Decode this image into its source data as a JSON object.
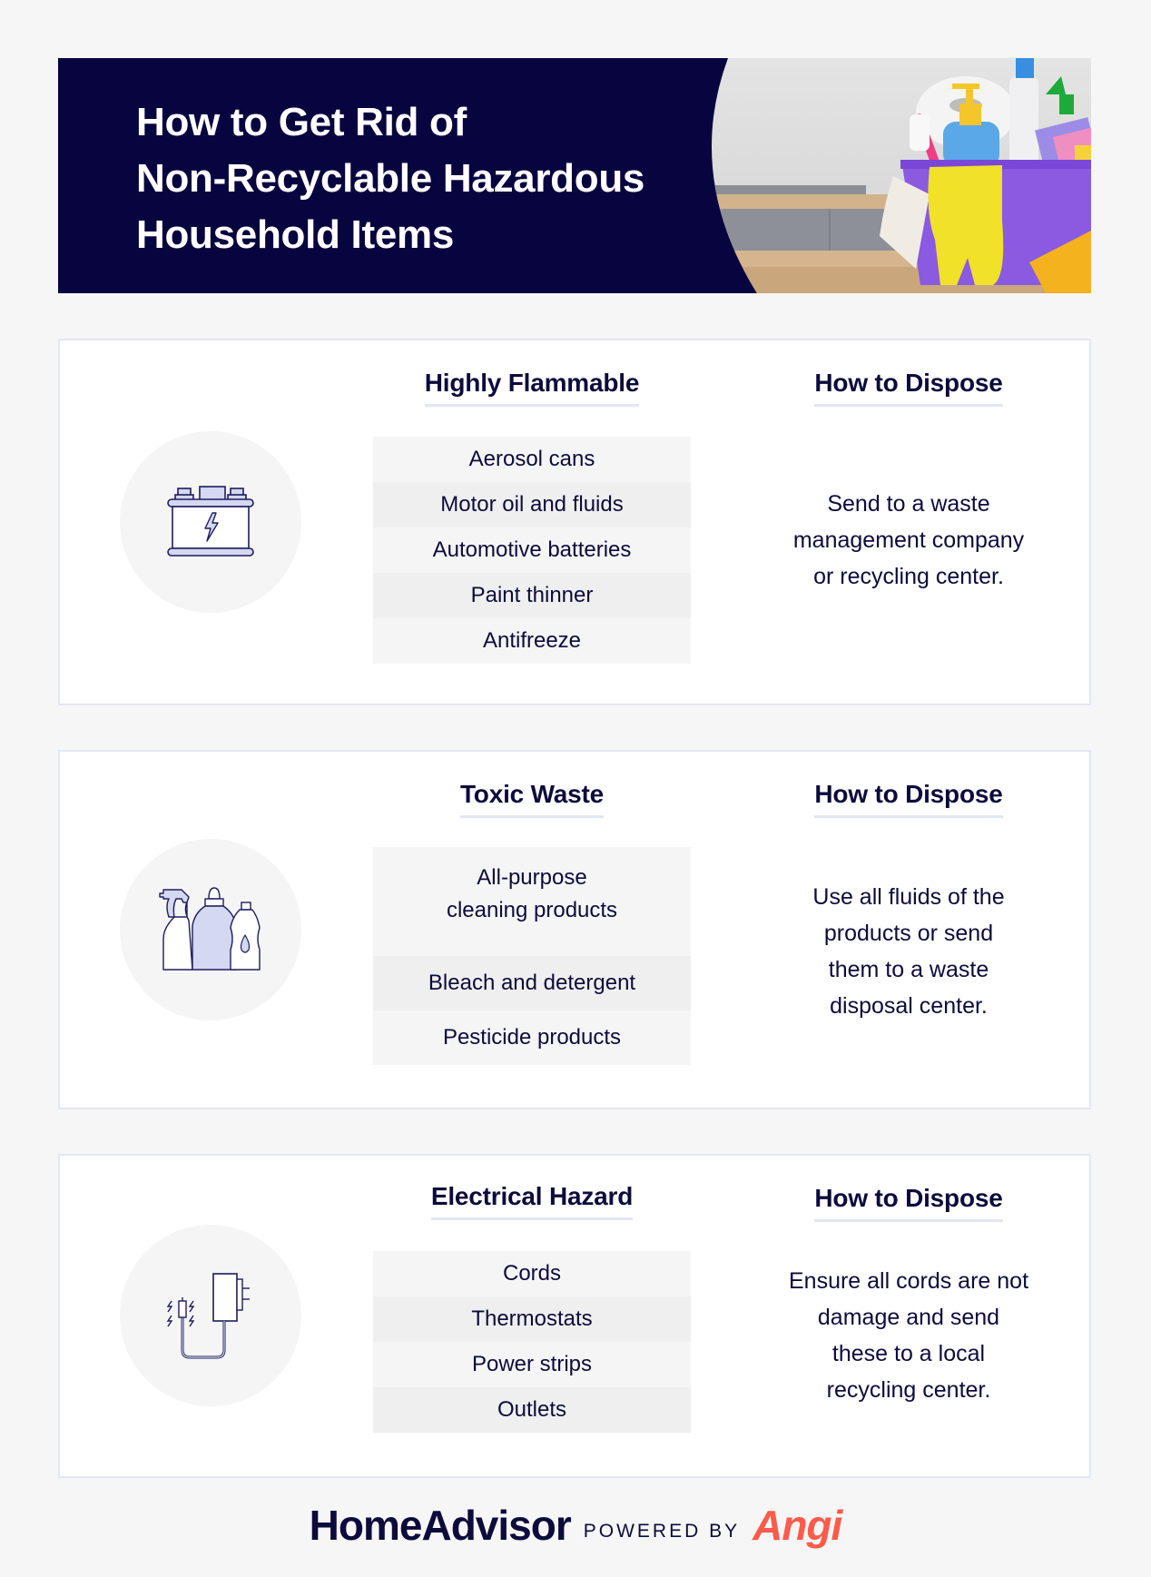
{
  "banner": {
    "title_lines": [
      "How to Get Rid of",
      "Non-Recyclable Hazardous",
      "Household Items"
    ],
    "photo": "cleaning-supplies-bucket-photo"
  },
  "sections": [
    {
      "icon": "car-battery-icon",
      "category": "Highly Flammable",
      "items": [
        "Aerosol cans",
        "Motor oil and fluids",
        "Automotive batteries",
        "Paint thinner",
        "Antifreeze"
      ],
      "dispose_heading": "How to Dispose",
      "dispose_lines": [
        "Send to a waste",
        "management company",
        "or recycling center."
      ]
    },
    {
      "icon": "cleaning-bottles-icon",
      "category": "Toxic Waste",
      "items": [
        "All-purpose\ncleaning products",
        "Bleach and detergent",
        "Pesticide products"
      ],
      "dispose_heading": "How to Dispose",
      "dispose_lines": [
        "Use all fluids of the",
        "products or send",
        "them to a waste",
        "disposal center."
      ]
    },
    {
      "icon": "power-adapter-cord-icon",
      "category": "Electrical Hazard",
      "items": [
        "Cords",
        "Thermostats",
        "Power strips",
        "Outlets"
      ],
      "dispose_heading": "How to Dispose",
      "dispose_lines": [
        "Ensure all cords are not",
        "damage and send",
        "these to a local",
        "recycling center."
      ]
    }
  ],
  "footer": {
    "brand": "HomeAdvisor",
    "powered_by": "POWERED BY",
    "partner": "Angi"
  },
  "colors": {
    "navy": "#08043f",
    "text": "#0d0b3b",
    "accent_lavender": "#d4d8f0",
    "angi_red": "#ff5a4a"
  }
}
